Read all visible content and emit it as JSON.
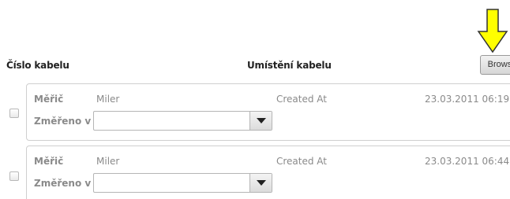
{
  "header": {
    "cable_number_label": "Číslo kabelu",
    "cable_location_label": "Umístění kabelu",
    "browse_button_label": "Browse"
  },
  "annotation": {
    "arrow_icon": "down-arrow-icon",
    "arrow_color": "#ffff00"
  },
  "records": [
    {
      "meter_label": "Měřič",
      "meter_value": "Miler",
      "created_label": "Created At",
      "created_value": "23.03.2011 06:19",
      "measured_in_label": "Změřeno v",
      "measured_in_value": ""
    },
    {
      "meter_label": "Měřič",
      "meter_value": "Miler",
      "created_label": "Created At",
      "created_value": "23.03.2011 06:44",
      "measured_in_label": "Změřeno v",
      "measured_in_value": ""
    }
  ]
}
